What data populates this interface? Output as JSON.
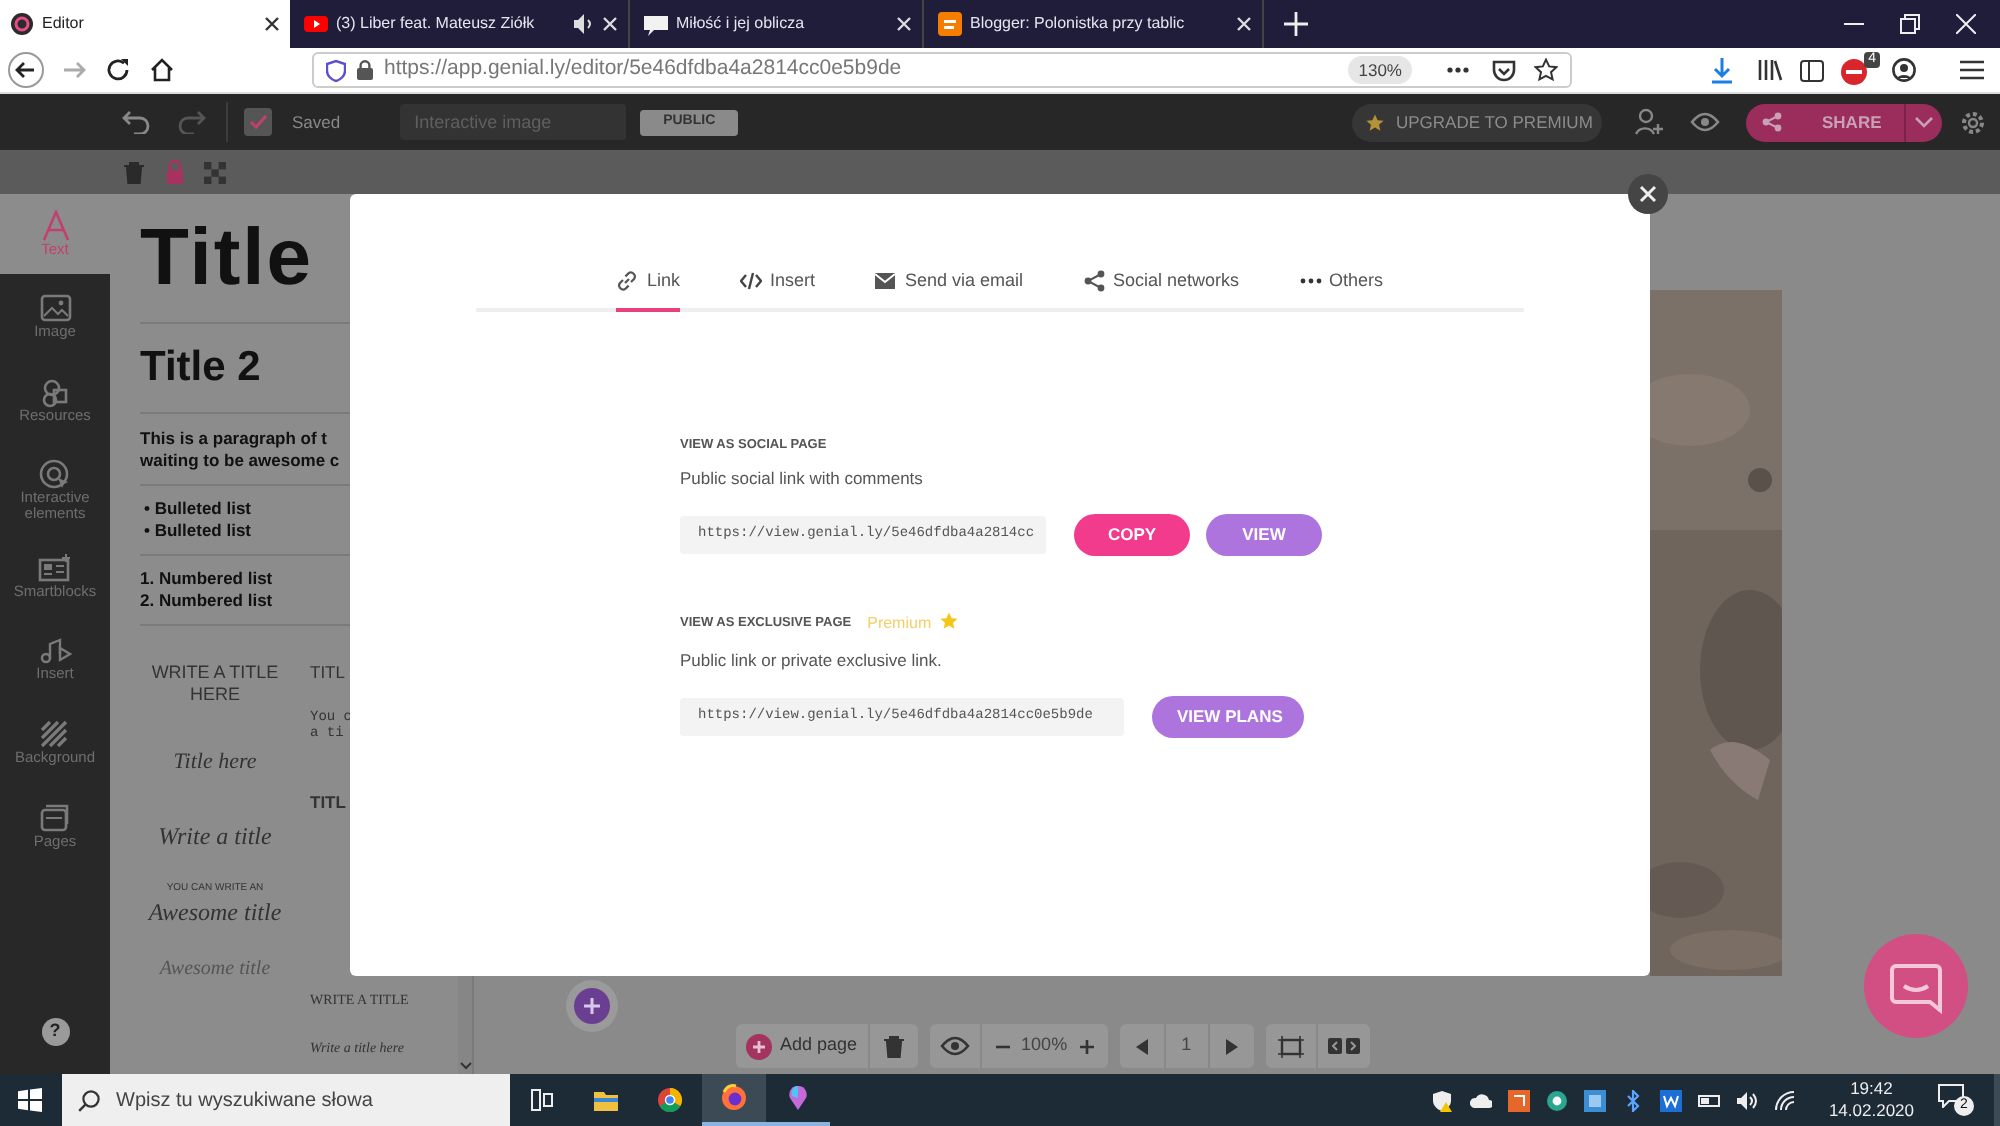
{
  "browser": {
    "tabs": [
      {
        "title": "Editor",
        "selected": true,
        "playing_audio": false
      },
      {
        "title": "(3) Liber feat. Mateusz Ziółk",
        "selected": false,
        "playing_audio": true
      },
      {
        "title": "Miłość i jej oblicza",
        "selected": false,
        "playing_audio": false
      },
      {
        "title": "Blogger: Polonistka przy tablic",
        "selected": false,
        "playing_audio": false
      }
    ],
    "url_host": "https://app.genial.ly",
    "url_path": "/editor/5e46dfdba4a2814cc0e5b9de",
    "zoom": "130%",
    "extension_badge": "4"
  },
  "app_toolbar": {
    "save_status": "Saved",
    "title_placeholder": "Interactive image",
    "visibility": "PUBLIC",
    "upgrade": "UPGRADE TO PREMIUM",
    "share": "SHARE"
  },
  "sidebar": {
    "items": [
      {
        "label": "Text",
        "selected": true
      },
      {
        "label": "Image",
        "selected": false
      },
      {
        "label": "Resources",
        "selected": false
      },
      {
        "label": "Interactive elements",
        "selected": false
      },
      {
        "label": "Smartblocks",
        "selected": false
      },
      {
        "label": "Insert",
        "selected": false
      },
      {
        "label": "Background",
        "selected": false
      },
      {
        "label": "Pages",
        "selected": false
      }
    ],
    "help": "?"
  },
  "text_panel": {
    "title_1": "Title",
    "title_2": "Title 2",
    "paragraph": [
      "This is a paragraph of t",
      "waiting to be awesome c"
    ],
    "bulleted": [
      "• Bulleted list",
      "• Bulleted list"
    ],
    "numbered": [
      "1. Numbered list",
      "2. Numbered list"
    ],
    "templates_left": [
      "WRITE A TITLE HERE",
      "Title here",
      "Write a title",
      "YOU CAN WRITE AN",
      "Awesome title",
      "Awesome title"
    ],
    "templates_right": [
      "TITL",
      "You c",
      "a ti",
      "TITL",
      "WRITE A TITLE",
      "Write a title here"
    ]
  },
  "dialog": {
    "tabs": [
      {
        "label": "Link",
        "selected": true
      },
      {
        "label": "Insert",
        "selected": false
      },
      {
        "label": "Send via email",
        "selected": false
      },
      {
        "label": "Social networks",
        "selected": false
      },
      {
        "label": "Others",
        "selected": false
      }
    ],
    "sections": [
      {
        "heading": "VIEW AS SOCIAL PAGE",
        "description": "Public social link with comments",
        "link": "https://view.genial.ly/5e46dfdba4a2814cc",
        "buttons": [
          {
            "label": "COPY",
            "kind": "primary"
          },
          {
            "label": "VIEW",
            "kind": "secondary"
          }
        ]
      },
      {
        "heading": "VIEW AS EXCLUSIVE PAGE",
        "badge": "Premium",
        "description": "Public link or private exclusive link.",
        "link": "https://view.genial.ly/5e46dfdba4a2814cc0e5b9de",
        "buttons": [
          {
            "label": "VIEW PLANS",
            "kind": "secondary"
          }
        ]
      }
    ]
  },
  "bottom_toolbar": {
    "add_page": "Add page",
    "zoom": "100%",
    "page": "1"
  },
  "taskbar": {
    "search_placeholder": "Wpisz tu wyszukiwane słowa",
    "time": "19:42",
    "date": "14.02.2020",
    "notifications": "2"
  }
}
